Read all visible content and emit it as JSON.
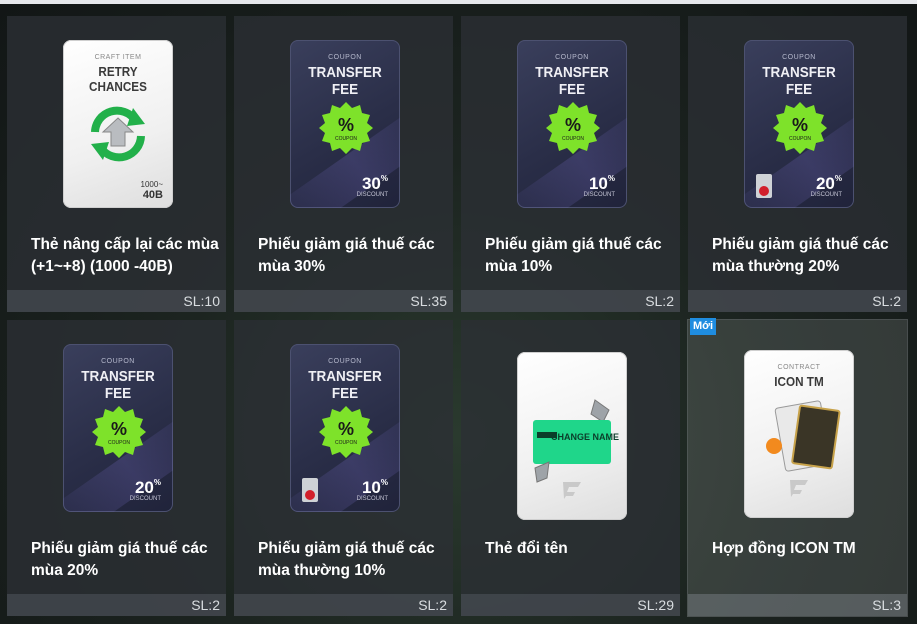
{
  "items": [
    {
      "title": "Thẻ nâng cấp lại các mùa (+1~+8) (1000 -40B)",
      "qty": "SL:10",
      "card": {
        "kind": "CRAFT ITEM",
        "name": "RETRY CHANCES",
        "range_top": "1000~",
        "range_bottom": "40B"
      },
      "icon": "retry-arrows-icon"
    },
    {
      "title": "Phiếu giảm giá thuế các mùa 30%",
      "qty": "SL:35",
      "card": {
        "kind": "COUPON",
        "name": "TRANSFER FEE",
        "percent": "30",
        "percent_sign": "%",
        "label": "DISCOUNT",
        "badge": "%",
        "badge_label": "COUPON"
      },
      "icon": "coupon-badge-icon"
    },
    {
      "title": "Phiếu giảm giá thuế các mùa 10%",
      "qty": "SL:2",
      "card": {
        "kind": "COUPON",
        "name": "TRANSFER FEE",
        "percent": "10",
        "percent_sign": "%",
        "label": "DISCOUNT",
        "badge": "%",
        "badge_label": "COUPON"
      },
      "icon": "coupon-badge-icon"
    },
    {
      "title": "Phiếu giảm giá thuế các mùa thường 20%",
      "qty": "SL:2",
      "card": {
        "kind": "COUPON",
        "name": "TRANSFER FEE",
        "percent": "20",
        "percent_sign": "%",
        "label": "DISCOUNT",
        "badge": "%",
        "badge_label": "COUPON"
      },
      "icon": "coupon-badge-icon",
      "restricted": true
    },
    {
      "title": "Phiếu giảm giá thuế các mùa 20%",
      "qty": "SL:2",
      "card": {
        "kind": "COUPON",
        "name": "TRANSFER FEE",
        "percent": "20",
        "percent_sign": "%",
        "label": "DISCOUNT",
        "badge": "%",
        "badge_label": "COUPON"
      },
      "icon": "coupon-badge-icon"
    },
    {
      "title": "Phiếu giảm giá thuế các mùa thường 10%",
      "qty": "SL:2",
      "card": {
        "kind": "COUPON",
        "name": "TRANSFER FEE",
        "percent": "10",
        "percent_sign": "%",
        "label": "DISCOUNT",
        "badge": "%",
        "badge_label": "COUPON"
      },
      "icon": "coupon-badge-icon",
      "restricted": true
    },
    {
      "title": "Thẻ đổi tên",
      "qty": "SL:29",
      "card": {
        "ticket": "CHANGE NAME"
      },
      "icon": "change-name-ticket-icon"
    },
    {
      "title": "Hợp đồng ICON TM",
      "qty": "SL:3",
      "badge": "Mới",
      "card": {
        "kind": "CONTRACT",
        "name": "ICON TM"
      },
      "icon": "contract-clipboard-icon"
    }
  ],
  "colors": {
    "coupon_green": "#7ee22a",
    "new_badge": "#1f8de0",
    "ticket_green": "#1fd68a"
  }
}
